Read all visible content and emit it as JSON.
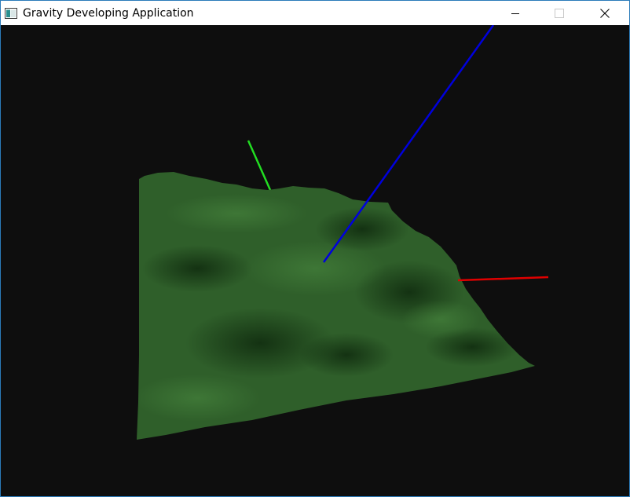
{
  "window": {
    "title": "Gravity Developing Application",
    "icon": "app-window-icon",
    "controls": {
      "minimize": "minimize-icon",
      "maximize": "maximize-icon",
      "close": "close-icon"
    }
  },
  "scene": {
    "background_color": "#0e0e0e",
    "terrain_color": "#2f5f2a",
    "axes": {
      "x_color": "#e00000",
      "y_color": "#22dd22",
      "z_color": "#0000dd"
    }
  }
}
